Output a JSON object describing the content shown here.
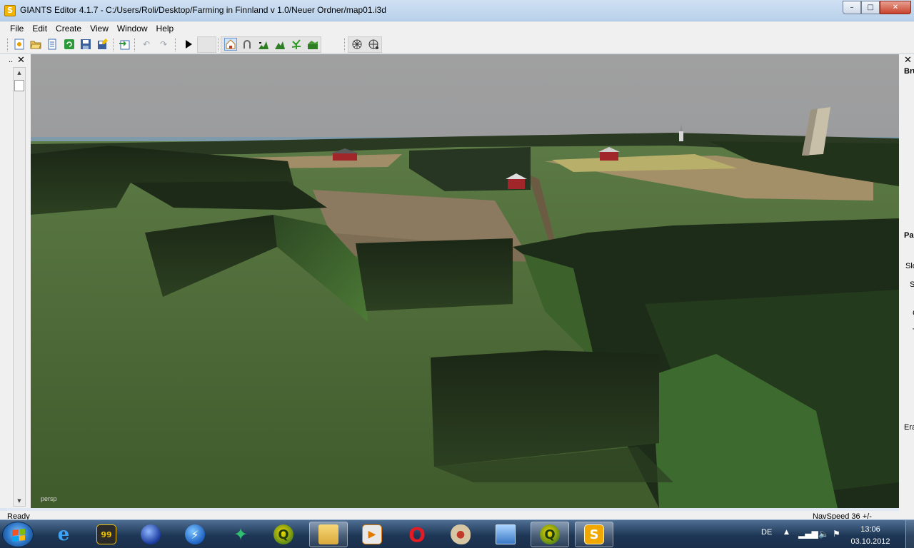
{
  "window": {
    "title": "GIANTS Editor 4.1.7 - C:/Users/Roli/Desktop/Farming in Finnland v 1.0/Neuer Ordner/map01.i3d",
    "app_icon_letter": "S",
    "minimize": "–",
    "maximize": "□",
    "close": "✕"
  },
  "menu": {
    "file": "File",
    "edit": "Edit",
    "create": "Create",
    "view": "View",
    "window": "Window",
    "help": "Help"
  },
  "toolbar": {
    "icons": [
      "new-scene-icon",
      "open-icon",
      "properties-icon",
      "refresh-icon",
      "save-icon",
      "save-as-icon",
      "import-icon",
      "undo-icon",
      "redo-icon",
      "play-icon",
      "select-mode-icon",
      "move-mode-icon",
      "terrain-raise-icon",
      "terrain-paint-icon",
      "foliage-paint-icon",
      "terrain-smooth-icon",
      "render-toggle-icon",
      "texture-toggle-icon"
    ]
  },
  "left_dock": {
    "dots": "..",
    "close": "✕"
  },
  "viewport": {
    "camera_label": "persp"
  },
  "right_dock": {
    "close": "✕",
    "labels": [
      "Bru",
      "Pa",
      "Slo",
      "S",
      "C",
      "T",
      "Era"
    ]
  },
  "status": {
    "left": "Ready",
    "right": "NavSpeed 36 +/-"
  },
  "taskbar": {
    "language": "DE",
    "time": "13:06",
    "date": "03.10.2012",
    "apps": [
      "internet-explorer",
      "game-launcher",
      "sphere-app",
      "bolt-app",
      "tree-app",
      "qgis",
      "file-explorer",
      "media-player",
      "opera",
      "paint",
      "remote-desktop",
      "qgis-active",
      "giants-editor-active"
    ]
  },
  "colors": {
    "sky": "#9f9f9f",
    "grass": "#506c38",
    "forest": "#1f2e18",
    "field": "#8b7a5f",
    "barn": "#a0262a",
    "taskbar": "#1e3756"
  }
}
